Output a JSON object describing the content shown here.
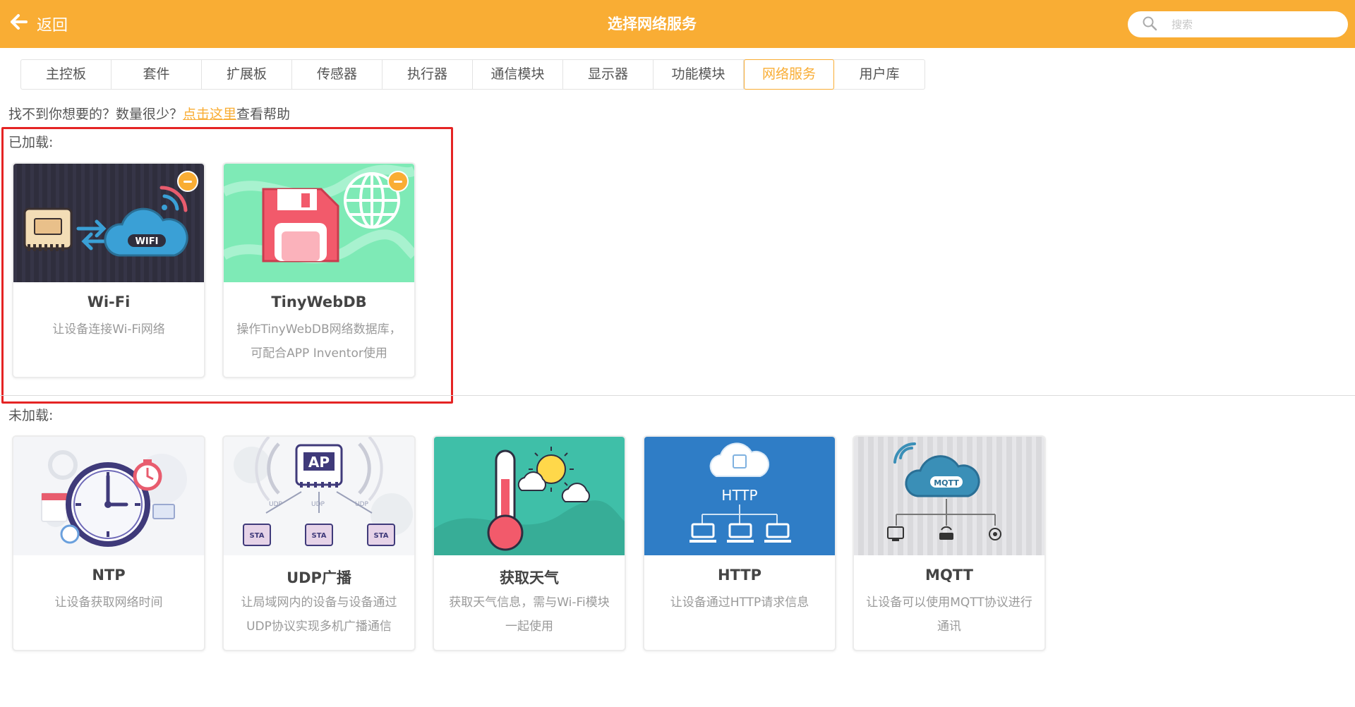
{
  "header": {
    "back_label": "返回",
    "title": "选择网络服务",
    "search_placeholder": "搜索"
  },
  "tabs": [
    {
      "label": "主控板",
      "active": false
    },
    {
      "label": "套件",
      "active": false
    },
    {
      "label": "扩展板",
      "active": false
    },
    {
      "label": "传感器",
      "active": false
    },
    {
      "label": "执行器",
      "active": false
    },
    {
      "label": "通信模块",
      "active": false
    },
    {
      "label": "显示器",
      "active": false
    },
    {
      "label": "功能模块",
      "active": false
    },
    {
      "label": "网络服务",
      "active": true
    },
    {
      "label": "用户库",
      "active": false
    }
  ],
  "help": {
    "prefix": "找不到你想要的？数量很少？",
    "link": "点击这里",
    "suffix": "查看帮助"
  },
  "loaded": {
    "label": "已加载:",
    "cards": [
      {
        "name": "Wi-Fi",
        "desc": "让设备连接Wi-Fi网络",
        "icon": "wifi-board-icon"
      },
      {
        "name": "TinyWebDB",
        "desc": "操作TinyWebDB网络数据库，可配合APP Inventor使用",
        "icon": "database-globe-icon"
      }
    ]
  },
  "unloaded": {
    "label": "未加载:",
    "cards": [
      {
        "name": "NTP",
        "desc": "让设备获取网络时间",
        "icon": "clock-icon"
      },
      {
        "name": "UDP广播",
        "desc": "让局域网内的设备与设备通过UDP协议实现多机广播通信",
        "icon": "udp-network-icon"
      },
      {
        "name": "获取天气",
        "desc": "获取天气信息，需与Wi-Fi模块一起使用",
        "icon": "weather-thermometer-icon"
      },
      {
        "name": "HTTP",
        "desc": "让设备通过HTTP请求信息",
        "icon": "http-cloud-icon"
      },
      {
        "name": "MQTT",
        "desc": "让设备可以使用MQTT协议进行通讯",
        "icon": "mqtt-cloud-icon"
      }
    ]
  },
  "image_text": {
    "wifi": "WIFI",
    "ap": "AP",
    "udp": "UDP",
    "sta": "STA",
    "http": "HTTP",
    "mqtt": "MQTT"
  },
  "colors": {
    "accent": "#f9ad34",
    "highlight_border": "#e52424"
  }
}
